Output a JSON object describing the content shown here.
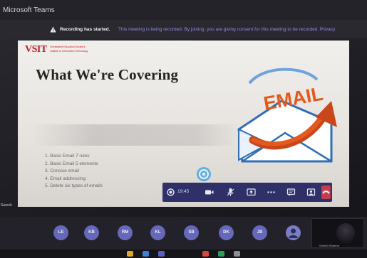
{
  "window": {
    "title": "Microsoft Teams"
  },
  "notice": {
    "strong": "Recording has started.",
    "text": "This meeting is being recorded. By joining, you are giving consent for this meeting to be recorded. Privacy"
  },
  "slide": {
    "logo": {
      "text": "VSIT",
      "line1": "Vivekanand Education Society's",
      "line2": "Institute of Information Technology"
    },
    "title": "What We're Covering",
    "art_word": "EMAIL",
    "bullets": [
      "1. Basic Email 7 rules",
      "2. Basic Email 5 elements",
      "3. Concise email",
      "4. Email addressing",
      "5. Delete six types of emails"
    ],
    "colors": {
      "logo_red": "#c31d27",
      "art_orange": "#e35a1c",
      "envelope_blue": "#2e6fb7"
    }
  },
  "callbar": {
    "timer": "19:45",
    "icons": [
      "record-icon",
      "camera-icon",
      "microphone-icon",
      "share-screen-icon",
      "more-options-icon",
      "chat-icon",
      "participants-icon",
      "hang-up-icon"
    ],
    "accent": "#303068",
    "hangup_color": "#c43d4c"
  },
  "left_label": "Suresh",
  "participants": [
    "LE",
    "KB",
    "RM",
    "KL",
    "SB",
    "DK",
    "JB"
  ],
  "self": {
    "name": "Suresh Sharma"
  }
}
